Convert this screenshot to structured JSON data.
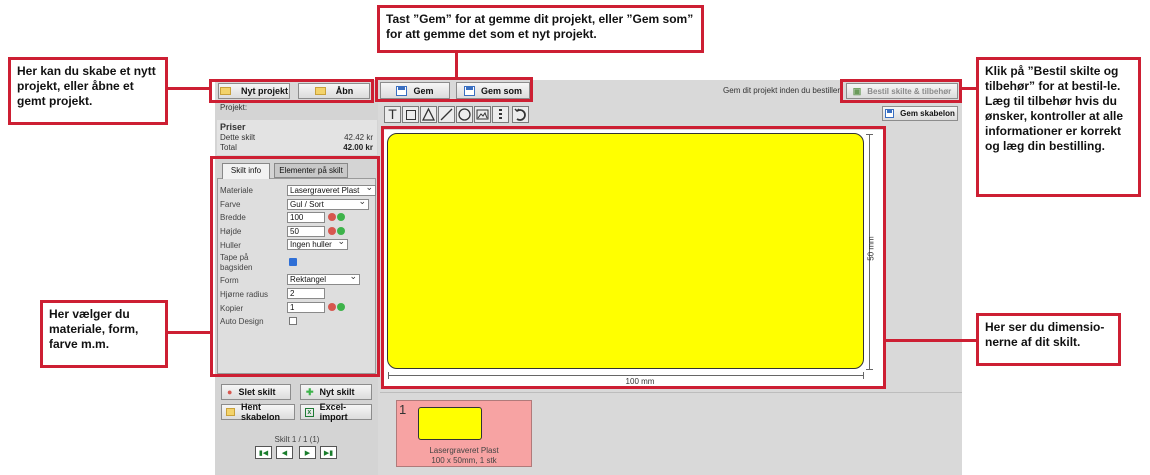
{
  "toolbar": {
    "new_project": "Nyt projekt",
    "open": "Åbn",
    "save": "Gem",
    "save_as": "Gem som",
    "save_hint": "Gem dit projekt inden du bestiller",
    "order": "Bestil skilte & tilbehør",
    "save_template": "Gem skabelon"
  },
  "project": {
    "label": "Projekt:"
  },
  "prices": {
    "title": "Priser",
    "this_sign_label": "Dette skilt",
    "this_sign_value": "42.42 kr",
    "total_label": "Total",
    "total_value": "42.00 kr"
  },
  "tabs": {
    "sign_info": "Skilt info",
    "elements": "Elementer på skilt"
  },
  "form": {
    "material_label": "Materiale",
    "material_value": "Lasergraveret Plast",
    "color_label": "Farve",
    "color_value": "Gul / Sort",
    "width_label": "Bredde",
    "width_value": "100",
    "height_label": "Højde",
    "height_value": "50",
    "holes_label": "Huller",
    "holes_value": "Ingen huller",
    "tape_label": "Tape på bagsiden",
    "shape_label": "Form",
    "shape_value": "Rektangel",
    "corner_label": "Hjørne radius",
    "corner_value": "2",
    "copies_label": "Kopier",
    "copies_value": "1",
    "autodesign_label": "Auto Design"
  },
  "actions": {
    "delete_sign": "Slet skilt",
    "new_sign": "Nyt skilt",
    "load_template": "Hent skabelon",
    "excel_import": "Excel-import"
  },
  "pager": {
    "text": "Skilt 1 / 1 (1)"
  },
  "canvas": {
    "sign_color": "#ffff00",
    "width_dim": "100 mm",
    "height_dim": "50 mm"
  },
  "thumbnail": {
    "index": "1",
    "line1": "Lasergraveret Plast",
    "line2": "100 x 50mm, 1 stk"
  },
  "callouts": {
    "left_top": "Her kan du skabe et nytt projekt, eller åbne et gemt projekt.",
    "top_center": "Tast ”Gem” for at gemme dit projekt, eller ”Gem som” for att gemme det som et nyt projekt.",
    "right_top": "Klik på ”Bestil skilte og tilbehør” for at bestil-le. Læg til tilbehør hvis du ønsker, kontroller at alle informationer er korrekt og læg din bestilling.",
    "left_mid": "Her vælger du materiale, form, farve m.m.",
    "right_mid": "Her ser du dimensio-nerne af dit skilt."
  },
  "colors": {
    "accent": "#cd1f33",
    "sign": "#ffff00",
    "thumb_bg": "#f7a3a3"
  }
}
